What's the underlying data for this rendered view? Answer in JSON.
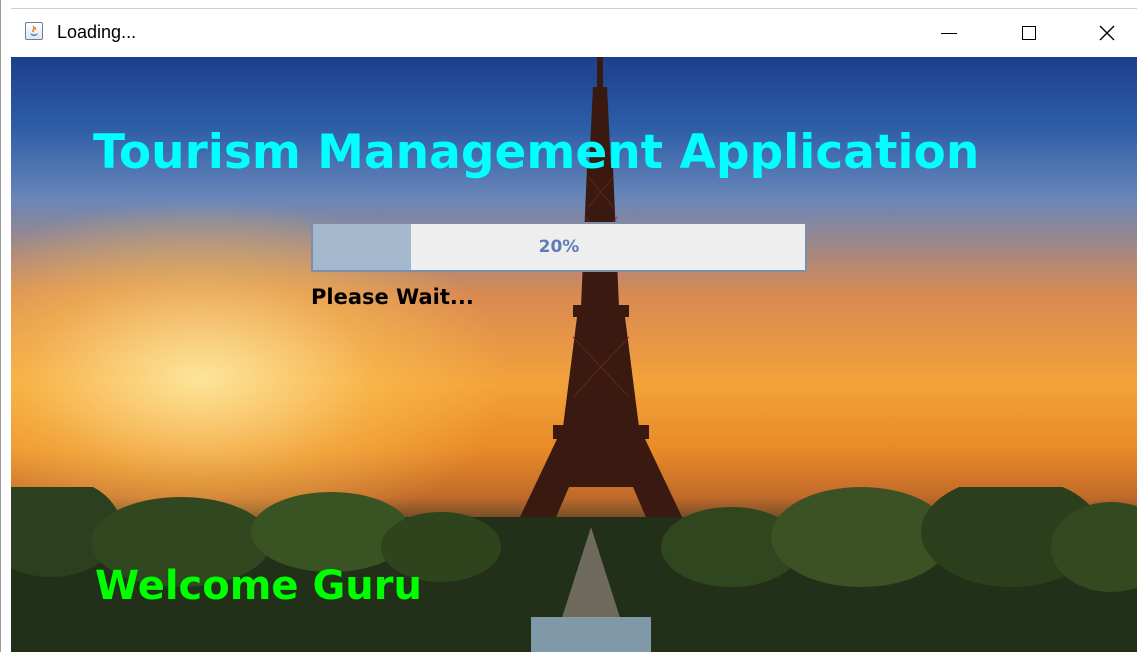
{
  "window": {
    "title": "Loading...",
    "icon": "java-app-icon",
    "controls": {
      "minimize_icon": "minimize-icon",
      "maximize_icon": "maximize-icon",
      "close_icon": "close-icon"
    }
  },
  "splash": {
    "title": "Tourism Management Application",
    "progress": {
      "value": 20,
      "label": "20%"
    },
    "status": "Please Wait...",
    "welcome": "Welcome Guru",
    "background_image": "eiffel-tower-sunset"
  },
  "colors": {
    "title": "#00ffff",
    "welcome": "#00ff00",
    "progress_fill": "#a3b8cc",
    "progress_track": "#eeeeee",
    "progress_text": "#5e7cb8",
    "status": "#000000"
  }
}
